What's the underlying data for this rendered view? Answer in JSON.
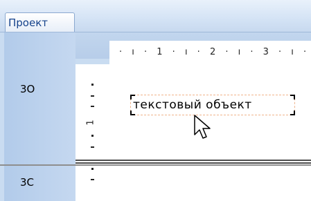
{
  "tab": {
    "label": "Проект"
  },
  "sections": [
    {
      "label": "3О"
    },
    {
      "label": "3С"
    }
  ],
  "ruler": {
    "horizontal": "· ı · 1 · ı · 2 · ı · 3 · ı ·",
    "vertical_number": "1"
  },
  "report_object": {
    "text": "текстовый объект"
  },
  "colors": {
    "tab_text": "#15428b",
    "panel": "#c5d8f0",
    "selection": "#f0b38a"
  }
}
